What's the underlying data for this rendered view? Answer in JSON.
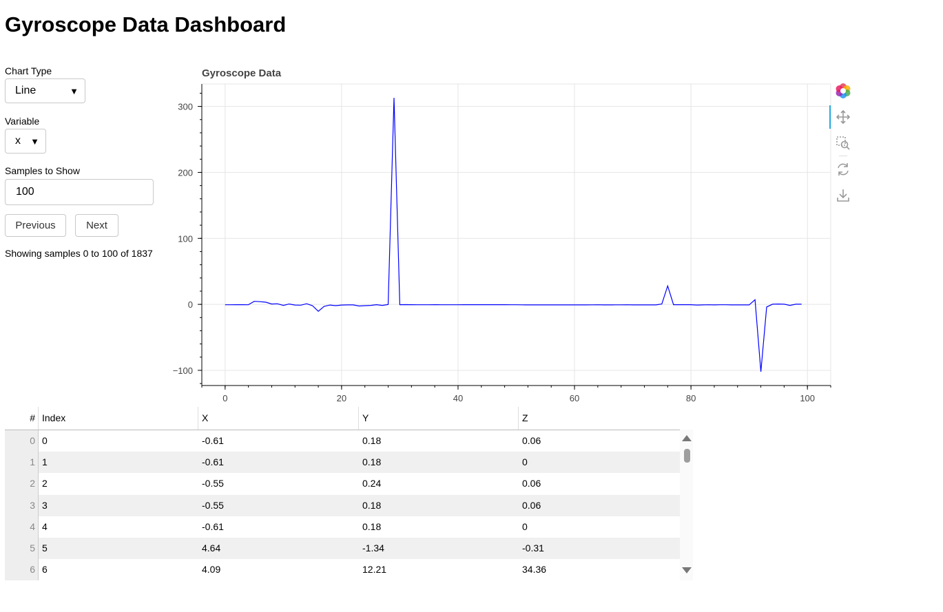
{
  "title": "Gyroscope Data Dashboard",
  "controls": {
    "chart_type_label": "Chart Type",
    "chart_type_value": "Line",
    "variable_label": "Variable",
    "variable_value": "x",
    "samples_label": "Samples to Show",
    "samples_value": "100",
    "previous_label": "Previous",
    "next_label": "Next",
    "status": "Showing samples 0 to 100 of 1837"
  },
  "colors": {
    "line": "#0000ff",
    "grid": "#e5e5e5",
    "toolbar_active": "#26aae1"
  },
  "toolbar": {
    "icons": [
      "bokeh-logo-icon",
      "pan-icon",
      "box-zoom-icon",
      "reset-icon",
      "save-icon"
    ]
  },
  "chart_data": {
    "type": "line",
    "title": "Gyroscope Data",
    "xlabel": "",
    "ylabel": "",
    "xlim": [
      -4,
      104
    ],
    "ylim": [
      -123,
      334
    ],
    "xticks": [
      0,
      20,
      40,
      60,
      80,
      100
    ],
    "yticks": [
      -100,
      0,
      100,
      200,
      300
    ],
    "tick_labels_x": [
      "0",
      "20",
      "40",
      "60",
      "80",
      "100"
    ],
    "tick_labels_y": [
      "−100",
      "0",
      "100",
      "200",
      "300"
    ],
    "grid": true,
    "series": [
      {
        "x": [
          0,
          1,
          2,
          3,
          4,
          5,
          6,
          7,
          8,
          9,
          10,
          11,
          12,
          13,
          14,
          15,
          16,
          17,
          18,
          19,
          20,
          21,
          22,
          23,
          24,
          25,
          26,
          27,
          28,
          29,
          30,
          31,
          32,
          33,
          34,
          35,
          36,
          37,
          38,
          39,
          40,
          41,
          42,
          43,
          44,
          45,
          46,
          47,
          48,
          49,
          50,
          51,
          52,
          53,
          54,
          55,
          56,
          57,
          58,
          59,
          60,
          61,
          62,
          63,
          64,
          65,
          66,
          67,
          68,
          69,
          70,
          71,
          72,
          73,
          74,
          75,
          76,
          77,
          78,
          79,
          80,
          81,
          82,
          83,
          84,
          85,
          86,
          87,
          88,
          89,
          90,
          91,
          92,
          93,
          94,
          95,
          96,
          97,
          98,
          99
        ],
        "values": [
          -0.61,
          -0.61,
          -0.55,
          -0.55,
          -0.61,
          4.64,
          4.09,
          3.2,
          0.5,
          0.8,
          -1.5,
          0.5,
          -1.0,
          -1.2,
          1.0,
          -2.0,
          -10.5,
          -3.0,
          -1.0,
          -2.0,
          -1.0,
          -0.8,
          -0.8,
          -2.5,
          -2.0,
          -1.5,
          -0.5,
          -1.5,
          -0.2,
          313,
          -0.5,
          -0.4,
          -0.5,
          -0.6,
          -0.6,
          -0.6,
          -0.5,
          -0.6,
          -0.6,
          -0.6,
          -0.6,
          -0.5,
          -0.5,
          -0.5,
          -0.5,
          -0.5,
          -0.5,
          -0.5,
          -0.5,
          -0.6,
          -0.6,
          -0.7,
          -0.8,
          -0.8,
          -0.8,
          -0.8,
          -0.8,
          -0.8,
          -0.7,
          -0.8,
          -0.8,
          -0.7,
          -0.8,
          -0.7,
          -0.6,
          -0.8,
          -0.8,
          -0.7,
          -0.7,
          -0.6,
          -0.8,
          -0.8,
          -0.8,
          -0.8,
          -0.8,
          0.5,
          28,
          -0.5,
          -0.5,
          -0.5,
          -0.5,
          -1.0,
          -0.8,
          -0.6,
          -0.8,
          -0.6,
          -0.6,
          -0.8,
          -0.8,
          -0.8,
          -0.8,
          7,
          -102,
          -4.0,
          0.2,
          0.5,
          0.2,
          -1.5,
          0.2,
          0.2
        ]
      }
    ]
  },
  "table": {
    "columns": [
      "#",
      "Index",
      "X",
      "Y",
      "Z"
    ],
    "rows": [
      [
        "0",
        "0",
        "-0.61",
        "0.18",
        "0.06"
      ],
      [
        "1",
        "1",
        "-0.61",
        "0.18",
        "0"
      ],
      [
        "2",
        "2",
        "-0.55",
        "0.24",
        "0.06"
      ],
      [
        "3",
        "3",
        "-0.55",
        "0.18",
        "0.06"
      ],
      [
        "4",
        "4",
        "-0.61",
        "0.18",
        "0"
      ],
      [
        "5",
        "5",
        "4.64",
        "-1.34",
        "-0.31"
      ],
      [
        "6",
        "6",
        "4.09",
        "12.21",
        "34.36"
      ]
    ]
  }
}
